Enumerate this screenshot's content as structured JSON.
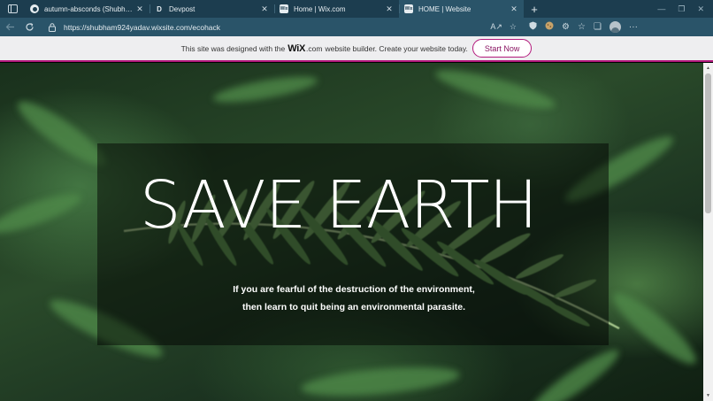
{
  "browser": {
    "tabs": [
      {
        "title": "autumn-absconds (Shubham Yadav)",
        "favicon": "github-icon",
        "active": false
      },
      {
        "title": "Devpost",
        "favicon": "devpost-icon",
        "active": false
      },
      {
        "title": "Home | Wix.com",
        "favicon": "wix-icon",
        "active": false
      },
      {
        "title": "HOME | Website",
        "favicon": "wix-icon",
        "active": true
      }
    ],
    "tab_close_glyph": "✕",
    "new_tab_glyph": "+",
    "url": "https://shubham924yadav.wixsite.com/ecohack"
  },
  "wix_banner": {
    "text_before": "This site was designed with the",
    "logo": "WiX",
    "dotcom": ".com",
    "text_after": "website builder. Create your website today.",
    "button_label": "Start Now"
  },
  "hero": {
    "title": "SAVE EARTH",
    "subtitle": "If you are fearful of the destruction of the environment, then learn to quit being an environmental parasite."
  },
  "colors": {
    "tabstrip": "#1c3d4f",
    "toolbar": "#2a5469",
    "wix_accent": "#b3197c",
    "banner_bg": "#eeeef0"
  }
}
